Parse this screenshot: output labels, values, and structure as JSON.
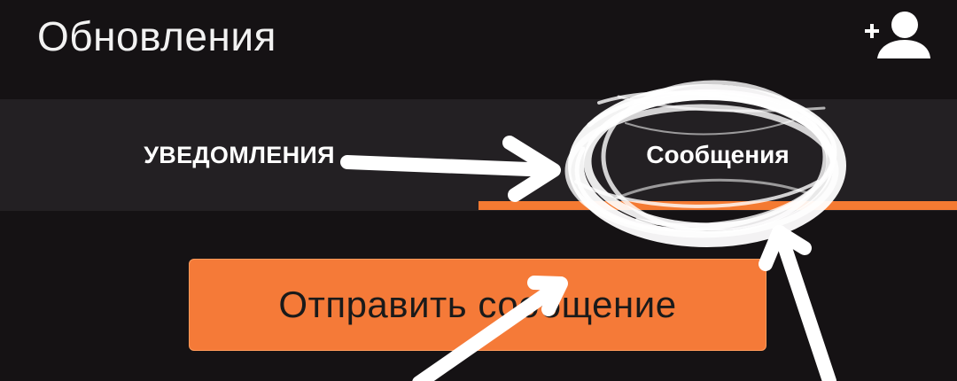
{
  "header": {
    "title": "Обновления",
    "add_friend_icon": "add-user-icon"
  },
  "tabs": [
    {
      "label": "УВЕДОМЛЕНИЯ",
      "selected": false
    },
    {
      "label": "Сообщения",
      "selected": true
    }
  ],
  "main": {
    "send_message_label": "Отправить сообщение"
  },
  "colors": {
    "background": "#151214",
    "tab_bar": "#232023",
    "accent": "#f47a32",
    "button": "#f57a38",
    "text": "#ffffff"
  }
}
